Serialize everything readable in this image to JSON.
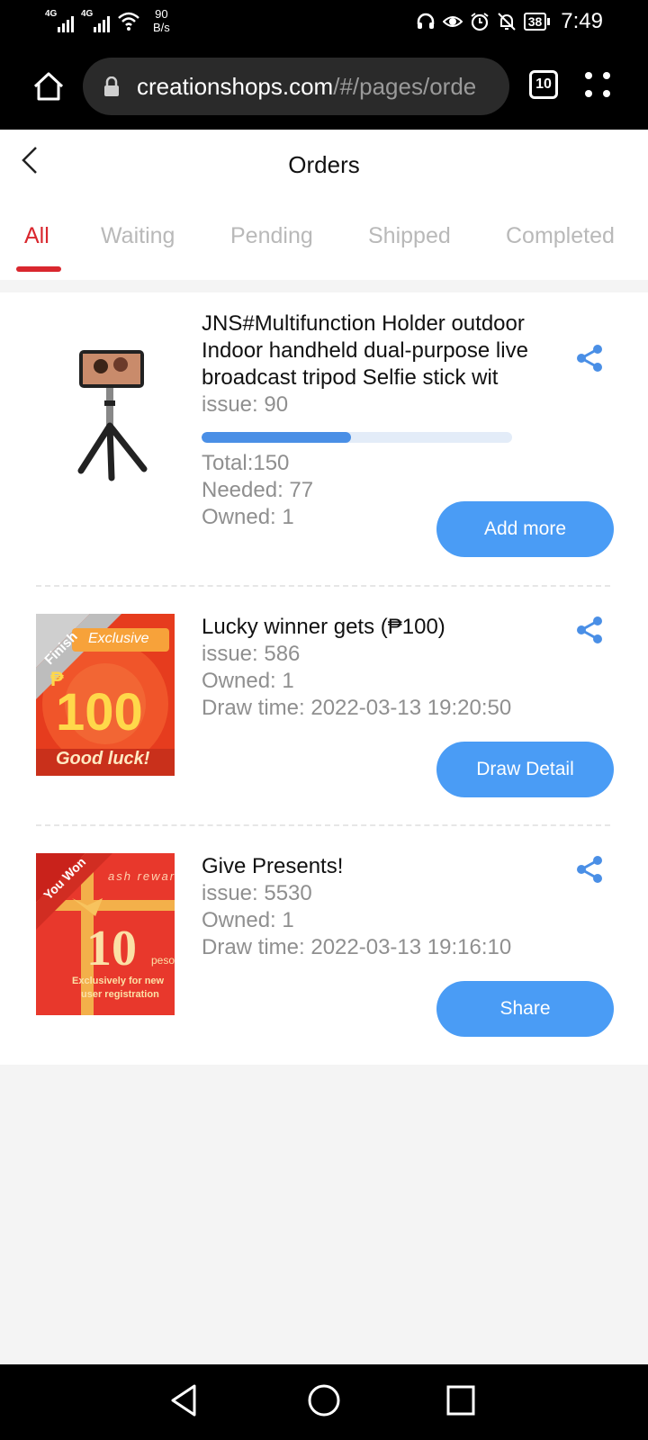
{
  "status_bar": {
    "network_1": "4G",
    "network_2": "4G",
    "speed_value": "90",
    "speed_unit": "B/s",
    "battery": "38",
    "time": "7:49"
  },
  "browser": {
    "url_host": "creationshops.com",
    "url_path": "/#/pages/orde",
    "tab_count": "10"
  },
  "page": {
    "title": "Orders"
  },
  "tabs": [
    {
      "label": "All",
      "active": true
    },
    {
      "label": "Waiting",
      "active": false
    },
    {
      "label": "Pending",
      "active": false
    },
    {
      "label": "Shipped",
      "active": false
    },
    {
      "label": "Completed",
      "active": false
    }
  ],
  "orders": [
    {
      "title": "JNS#Multifunction Holder outdoor Indoor handheld dual-purpose live broadcast tripod Selfie stick wit",
      "issue": "issue: 90",
      "progress_fraction": 0.48,
      "total": "Total:150",
      "needed": "Needed: 77",
      "owned": "Owned: 1",
      "button": "Add more"
    },
    {
      "title": "Lucky winner gets (₱100)",
      "issue": "issue: 586",
      "owned": "Owned: 1",
      "draw_time": "Draw time: 2022-03-13 19:20:50",
      "button": "Draw Detail",
      "thumb": {
        "ribbon": "Finish",
        "banner": "Exclusive",
        "currency": "₱",
        "amount": "100",
        "slogan": "Good luck!"
      }
    },
    {
      "title": "Give Presents!",
      "issue": "issue: 5530",
      "owned": "Owned: 1",
      "draw_time": "Draw time: 2022-03-13 19:16:10",
      "button": "Share",
      "thumb": {
        "ribbon": "You Won",
        "banner": "ash reward",
        "amount": "10",
        "unit": "peso",
        "line1": "Exclusively for new",
        "line2": "user registration"
      }
    }
  ],
  "colors": {
    "accent_red": "#d9272e",
    "button_blue": "#4a9cf5",
    "progress_blue": "#4a8fe6"
  }
}
